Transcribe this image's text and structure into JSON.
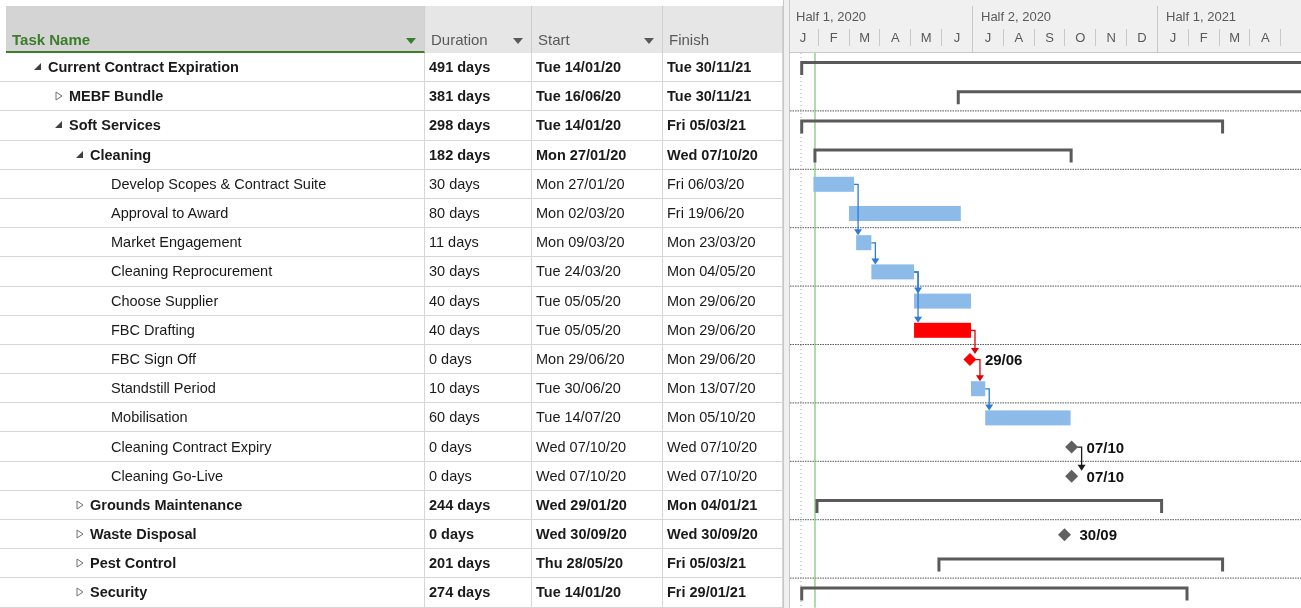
{
  "columns": [
    {
      "label": "Task Name",
      "selected": true
    },
    {
      "label": "Duration",
      "selected": false
    },
    {
      "label": "Start",
      "selected": false
    },
    {
      "label": "Finish",
      "selected": false
    }
  ],
  "timescale": [
    {
      "label": "Half 1, 2020",
      "months": [
        "J",
        "F",
        "M",
        "A",
        "M",
        "J"
      ]
    },
    {
      "label": "Half 2, 2020",
      "months": [
        "J",
        "A",
        "S",
        "O",
        "N",
        "D"
      ]
    },
    {
      "label": "Half 1, 2021",
      "months": [
        "J",
        "F",
        "M",
        "A"
      ]
    }
  ],
  "rows": [
    {
      "name": "Current Contract Expiration",
      "kind": "summary",
      "expanded": true,
      "duration": "491 days",
      "start": "Tue 14/01/20",
      "finish": "Tue 30/11/21",
      "children": [
        {
          "name": "MEBF Bundle",
          "kind": "summary",
          "expanded": false,
          "duration": "381 days",
          "start": "Tue 16/06/20",
          "finish": "Tue 30/11/21"
        },
        {
          "name": "Soft Services",
          "kind": "summary",
          "expanded": true,
          "duration": "298 days",
          "start": "Tue 14/01/20",
          "finish": "Fri 05/03/21",
          "children": [
            {
              "name": "Cleaning",
              "kind": "summary",
              "expanded": true,
              "duration": "182 days",
              "start": "Mon 27/01/20",
              "finish": "Wed 07/10/20",
              "children": [
                {
                  "name": "Develop Scopes & Contract Suite",
                  "kind": "task",
                  "duration": "30 days",
                  "start": "Mon 27/01/20",
                  "finish": "Fri 06/03/20",
                  "critical": false
                },
                {
                  "name": "Approval to Award",
                  "kind": "task",
                  "duration": "80 days",
                  "start": "Mon 02/03/20",
                  "finish": "Fri 19/06/20",
                  "critical": false
                },
                {
                  "name": "Market Engagement",
                  "kind": "task",
                  "duration": "11 days",
                  "start": "Mon 09/03/20",
                  "finish": "Mon 23/03/20",
                  "critical": false,
                  "linked": true,
                  "link_skips_row": true
                },
                {
                  "name": "Cleaning Reprocurement",
                  "kind": "task",
                  "duration": "30 days",
                  "start": "Tue 24/03/20",
                  "finish": "Mon 04/05/20",
                  "critical": false,
                  "linked": true
                },
                {
                  "name": "Choose Supplier",
                  "kind": "task",
                  "duration": "40 days",
                  "start": "Tue 05/05/20",
                  "finish": "Mon 29/06/20",
                  "critical": false,
                  "linked": true
                },
                {
                  "name": "FBC Drafting",
                  "kind": "task",
                  "duration": "40 days",
                  "start": "Tue 05/05/20",
                  "finish": "Mon 29/06/20",
                  "critical": true,
                  "linked": true,
                  "link_skips_row": true
                },
                {
                  "name": "FBC Sign Off",
                  "kind": "milestone",
                  "duration": "0 days",
                  "start": "Mon 29/06/20",
                  "finish": "Mon 29/06/20",
                  "critical": true,
                  "bar_label": "29/06",
                  "linked": true
                },
                {
                  "name": "Standstill Period",
                  "kind": "task",
                  "duration": "10 days",
                  "start": "Tue 30/06/20",
                  "finish": "Mon 13/07/20",
                  "critical": false,
                  "linked": true
                },
                {
                  "name": "Mobilisation",
                  "kind": "task",
                  "duration": "60 days",
                  "start": "Tue 14/07/20",
                  "finish": "Mon 05/10/20",
                  "critical": false,
                  "linked": true
                },
                {
                  "name": "Cleaning Contract Expiry",
                  "kind": "milestone",
                  "duration": "0 days",
                  "start": "Wed 07/10/20",
                  "finish": "Wed 07/10/20",
                  "critical": false,
                  "bar_label": "07/10"
                },
                {
                  "name": "Cleaning Go-Live",
                  "kind": "milestone",
                  "duration": "0 days",
                  "start": "Wed 07/10/20",
                  "finish": "Wed 07/10/20",
                  "critical": false,
                  "bar_label": "07/10",
                  "linked": true
                }
              ]
            },
            {
              "name": "Grounds Maintenance",
              "kind": "summary",
              "expanded": false,
              "duration": "244 days",
              "start": "Wed 29/01/20",
              "finish": "Mon 04/01/21"
            },
            {
              "name": "Waste Disposal",
              "kind": "summary_milestone",
              "expanded": false,
              "duration": "0 days",
              "start": "Wed 30/09/20",
              "finish": "Wed 30/09/20",
              "critical": false,
              "bar_label": "30/09"
            },
            {
              "name": "Pest Control",
              "kind": "summary",
              "expanded": false,
              "duration": "201 days",
              "start": "Thu 28/05/20",
              "finish": "Fri 05/03/21"
            },
            {
              "name": "Security",
              "kind": "summary",
              "expanded": false,
              "duration": "274 days",
              "start": "Tue 14/01/20",
              "finish": "Fri 29/01/21"
            }
          ]
        }
      ]
    }
  ]
}
